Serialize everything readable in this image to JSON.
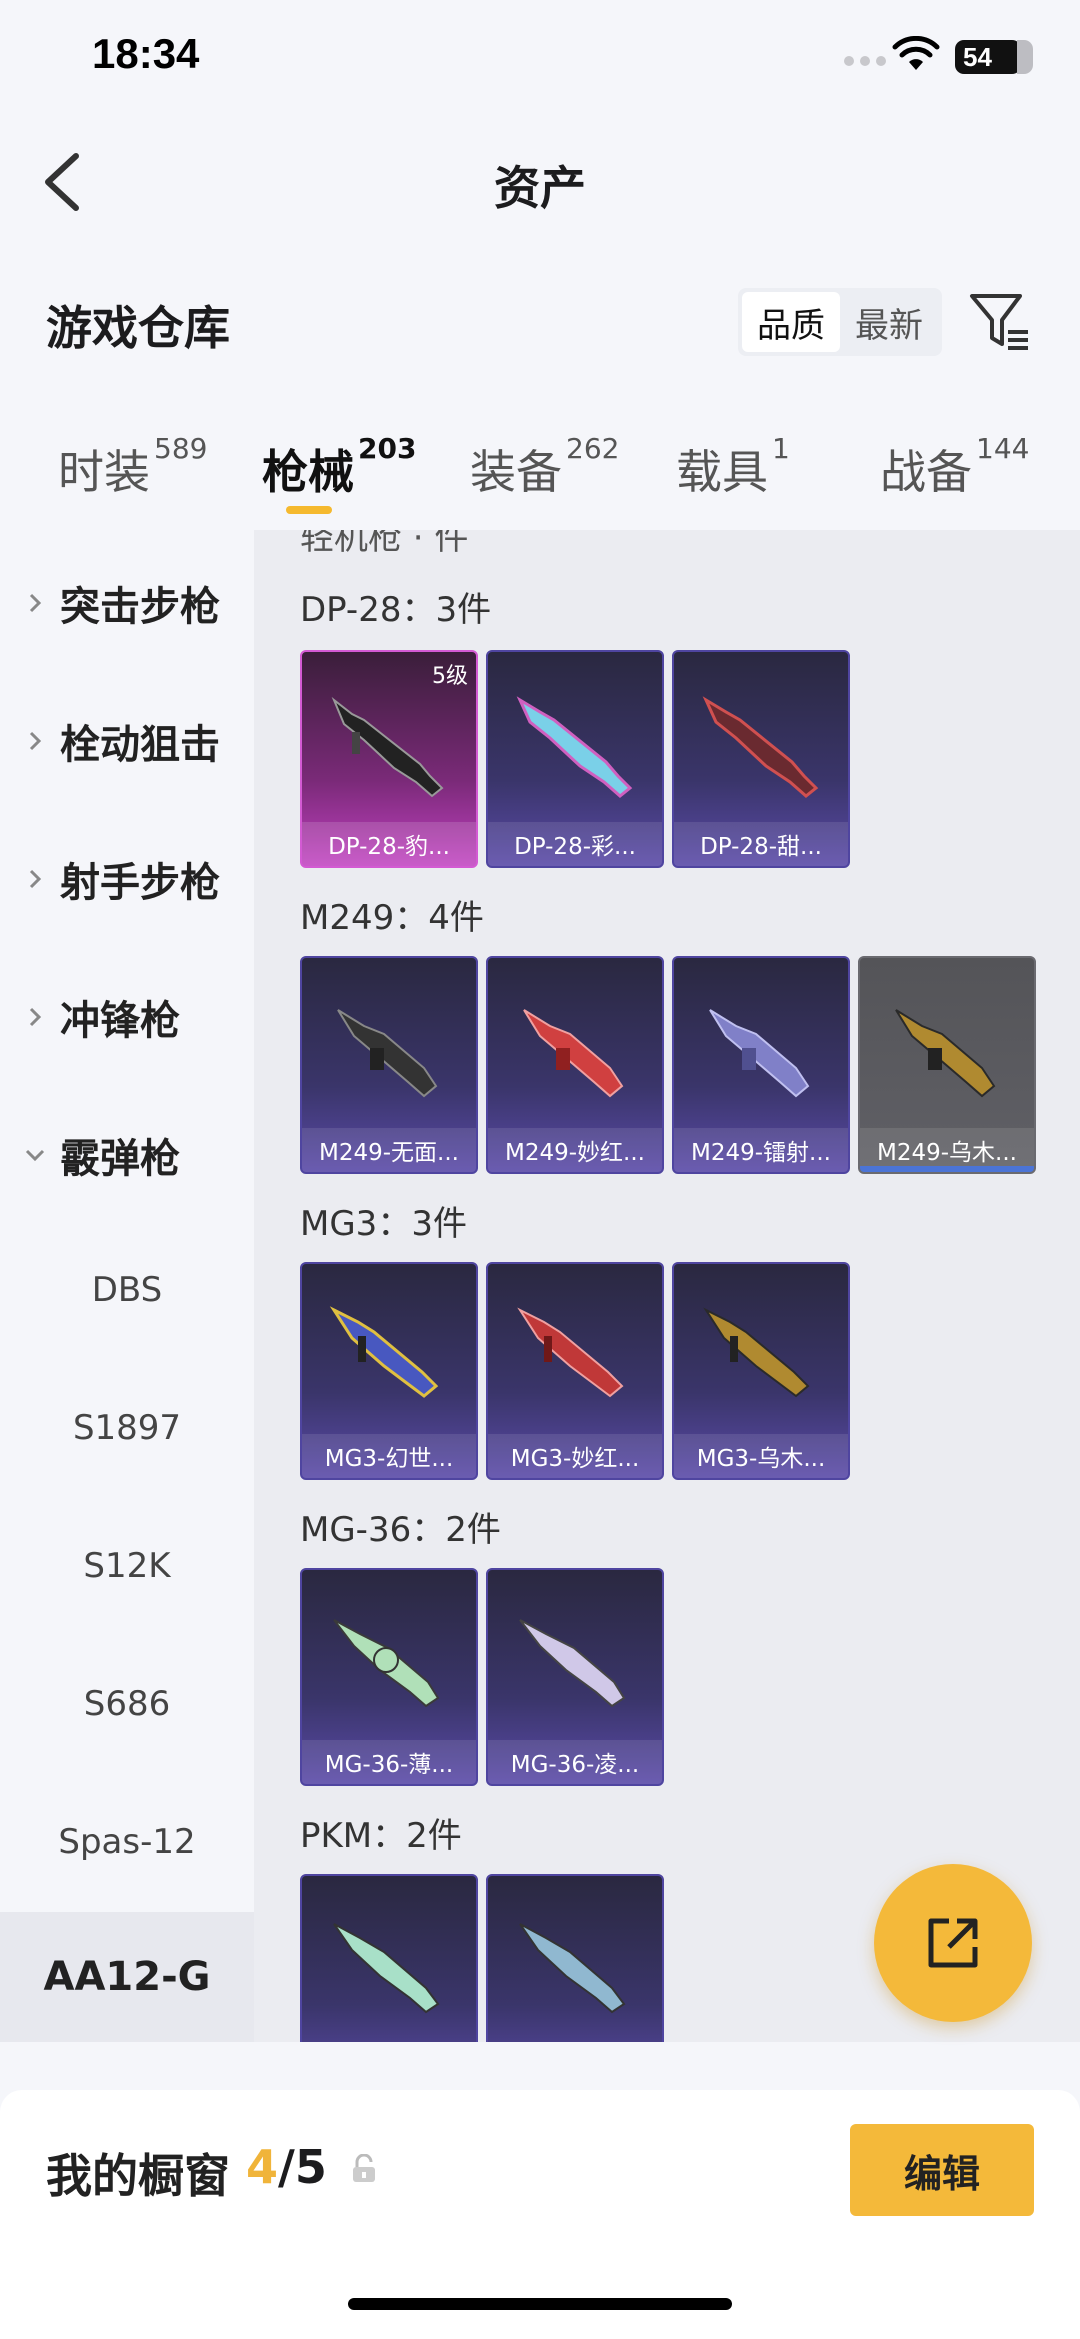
{
  "status_bar": {
    "time": "18:34",
    "battery": "54"
  },
  "header": {
    "title": "资产"
  },
  "warehouse": {
    "title": "游戏仓库",
    "sort": [
      "品质",
      "最新"
    ]
  },
  "tabs": [
    {
      "label": "时装",
      "count": "589"
    },
    {
      "label": "枪械",
      "count": "203"
    },
    {
      "label": "装备",
      "count": "262"
    },
    {
      "label": "载具",
      "count": "1"
    },
    {
      "label": "战备",
      "count": "144"
    }
  ],
  "sidebar": {
    "categories": [
      "突击步枪",
      "栓动狙击",
      "射手步枪",
      "冲锋枪",
      "霰弹枪"
    ],
    "subitems": [
      "DBS",
      "S1897",
      "S12K",
      "S686",
      "Spas-12"
    ],
    "active": "AA12-G"
  },
  "main": {
    "clipped_header": "轻机枪 · 件",
    "groups": [
      {
        "title": "DP-28：3件",
        "items": [
          "DP-28-豹...",
          "DP-28-彩...",
          "DP-28-甜..."
        ],
        "level": "5级"
      },
      {
        "title": "M249：4件",
        "items": [
          "M249-无面...",
          "M249-妙红...",
          "M249-镭射...",
          "M249-乌木..."
        ]
      },
      {
        "title": "MG3：3件",
        "items": [
          "MG3-幻世...",
          "MG3-妙红...",
          "MG3-乌木..."
        ]
      },
      {
        "title": "MG-36：2件",
        "items": [
          "MG-36-薄...",
          "MG-36-凌..."
        ]
      },
      {
        "title": "PKM：2件",
        "items": [
          "",
          ""
        ]
      }
    ]
  },
  "bottom": {
    "label": "我的橱窗",
    "count_current": "4",
    "count_total": "/5",
    "edit_label": "编辑"
  },
  "colors": {
    "accent": "#f4b93a",
    "card_purple": "#3a356a",
    "card_pink": "#c040c0"
  }
}
